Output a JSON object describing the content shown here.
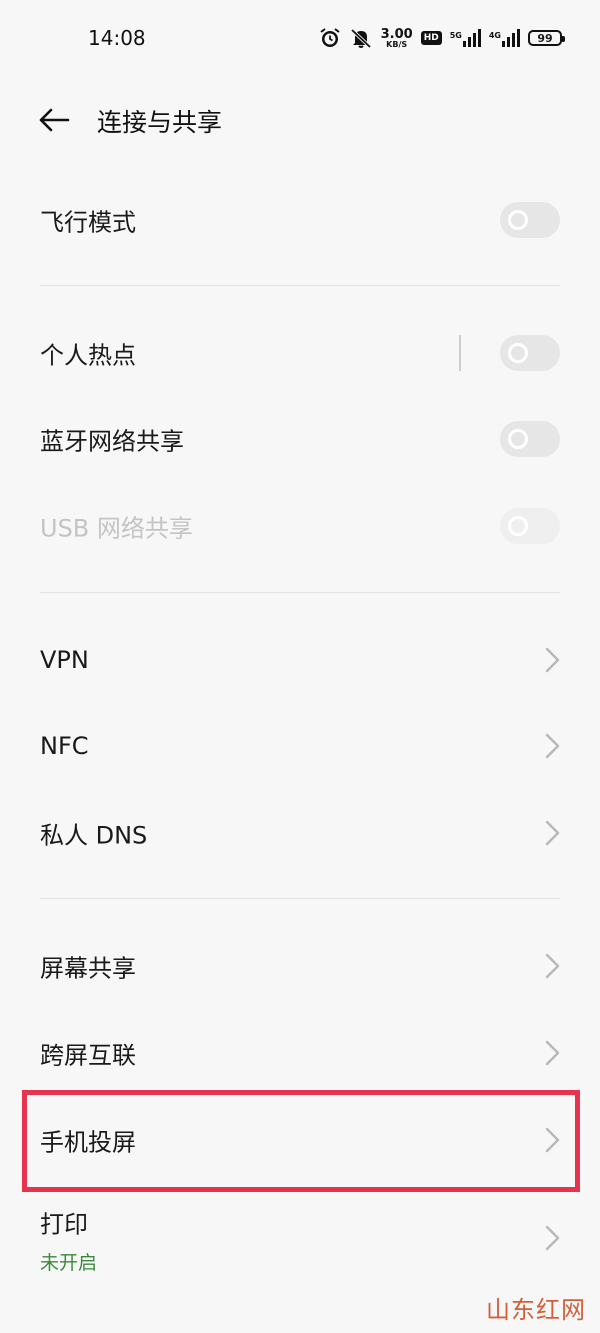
{
  "status_bar": {
    "time": "14:08",
    "net_speed_value": "3.00",
    "net_speed_unit": "KB/S",
    "hd_label": "HD",
    "sim1_tag": "5G",
    "sim2_tag": "4G",
    "battery": "99"
  },
  "header": {
    "title": "连接与共享"
  },
  "rows": {
    "airplane": {
      "label": "飞行模式",
      "on": false
    },
    "hotspot": {
      "label": "个人热点",
      "on": false
    },
    "bt_tether": {
      "label": "蓝牙网络共享",
      "on": false
    },
    "usb_tether": {
      "label": "USB 网络共享",
      "on": false,
      "enabled": false
    },
    "vpn": {
      "label": "VPN"
    },
    "nfc": {
      "label": "NFC"
    },
    "private_dns": {
      "label": "私人 DNS"
    },
    "screen_share": {
      "label": "屏幕共享"
    },
    "cross_screen": {
      "label": "跨屏互联"
    },
    "phone_cast": {
      "label": "手机投屏"
    },
    "print": {
      "label": "打印",
      "status": "未开启"
    }
  },
  "colors": {
    "highlight": "#e8334e",
    "status_green": "#3a8a3a",
    "watermark": "#d4603a"
  },
  "watermark": "山东红网"
}
